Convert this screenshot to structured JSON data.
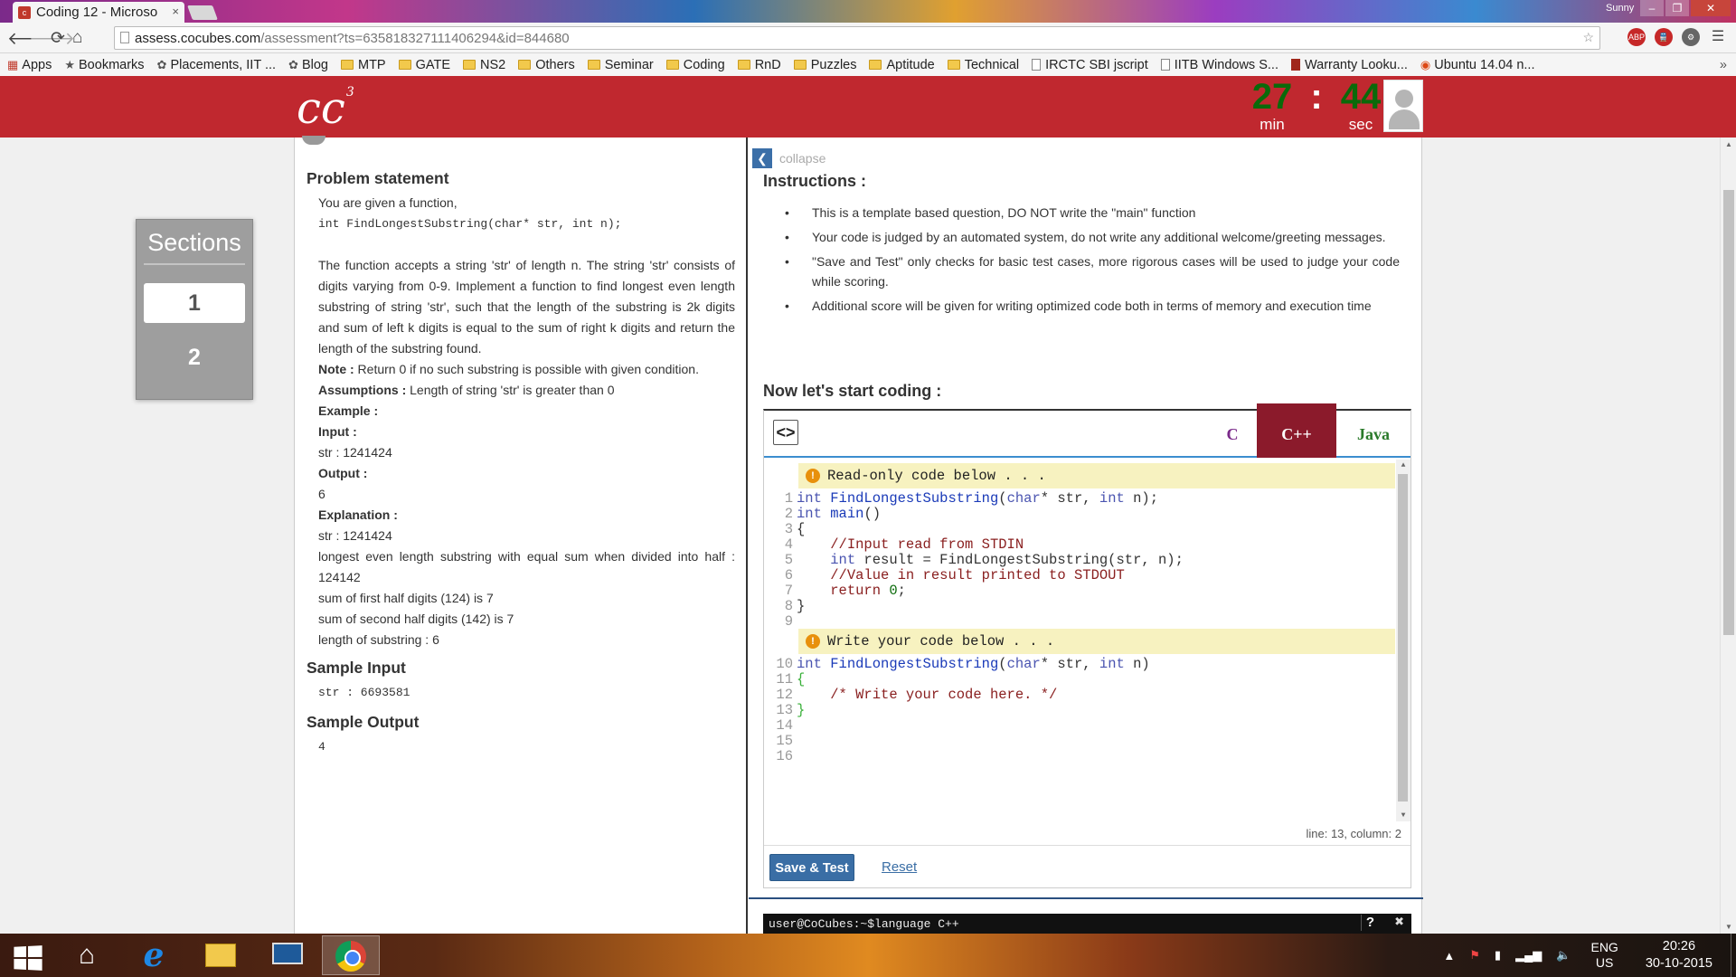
{
  "browser": {
    "tab_title": "Coding 12 - Microso",
    "tab_close": "×",
    "profile_name": "Sunny",
    "url_host": "assess.cocubes.com",
    "url_path": "/assessment?ts=635818327111406294&id=844680",
    "bookmarks": [
      {
        "label": "Apps",
        "kind": "apps"
      },
      {
        "label": "Bookmarks",
        "kind": "star"
      },
      {
        "label": "Placements, IIT ...",
        "kind": "glyph"
      },
      {
        "label": "Blog",
        "kind": "glyph"
      },
      {
        "label": "MTP",
        "kind": "folder"
      },
      {
        "label": "GATE",
        "kind": "folder"
      },
      {
        "label": "NS2",
        "kind": "folder"
      },
      {
        "label": "Others",
        "kind": "folder"
      },
      {
        "label": "Seminar",
        "kind": "folder"
      },
      {
        "label": "Coding",
        "kind": "folder"
      },
      {
        "label": "RnD",
        "kind": "folder"
      },
      {
        "label": "Puzzles",
        "kind": "folder"
      },
      {
        "label": "Aptitude",
        "kind": "folder"
      },
      {
        "label": "Technical",
        "kind": "folder"
      },
      {
        "label": "IRCTC SBI jscript",
        "kind": "page"
      },
      {
        "label": "IITB Windows S...",
        "kind": "page"
      },
      {
        "label": "Warranty Looku...",
        "kind": "page"
      },
      {
        "label": "Ubuntu 14.04 n...",
        "kind": "page"
      }
    ]
  },
  "header": {
    "logo_text": "c",
    "logo_sup": "3",
    "timer": {
      "minutes": "27",
      "seconds": "44",
      "min_label": "min",
      "sec_label": "sec",
      "separator": ":"
    }
  },
  "sections": {
    "title": "Sections",
    "items": [
      "1",
      "2"
    ]
  },
  "problem": {
    "heading": "Problem statement",
    "intro": "You are given a function,",
    "signature": "int FindLongestSubstring(char* str, int n);",
    "description": "The function accepts a string 'str' of length n. The string 'str' consists of digits varying from 0-9. Implement a function to find longest even length substring of string 'str', such that the length of the substring is 2k digits and sum of left k digits is equal to the sum of right k digits and return the length of the substring found.",
    "note_label": "Note :",
    "note_text": " Return 0 if no such substring is possible with given condition.",
    "assumptions_label": "Assumptions :",
    "assumptions_text": " Length of string 'str' is greater than 0",
    "example_label": "Example :",
    "input_label": "Input :",
    "input_value": "str : 1241424",
    "output_label": "Output :",
    "output_value": "6",
    "explanation_label": "Explanation :",
    "explanation_lines": [
      "str : 1241424",
      "longest even length substring with equal sum when divided into half : 124142",
      "sum of first half digits (124) is 7",
      "sum of second half digits (142) is 7",
      "length of substring : 6"
    ],
    "sample_input_heading": "Sample Input",
    "sample_input": "str : 6693581",
    "sample_output_heading": "Sample Output",
    "sample_output": "4"
  },
  "instructions": {
    "collapse_label": "collapse",
    "heading": "Instructions :",
    "items": [
      "This is a template based question, DO NOT write the \"main\" function",
      "Your code is judged by an automated system, do not write any additional welcome/greeting messages.",
      "\"Save and Test\" only checks for basic test cases, more rigorous cases will be used to judge your code while scoring.",
      "Additional score will be given for writing optimized code both in terms of memory and execution time"
    ],
    "coding_heading": "Now let's start coding :"
  },
  "editor": {
    "code_icon": "<>",
    "languages": [
      "C",
      "C++",
      "Java"
    ],
    "selected_language": "C++",
    "readonly_banner": "Read-only code below . . .",
    "write_banner": "Write your code below . . .",
    "status": "line: 13, column: 2",
    "save_label": "Save & Test",
    "reset_label": "Reset"
  },
  "console": {
    "text": "user@CoCubes:~$language C++",
    "help": "?"
  },
  "taskbar": {
    "lang_top": "ENG",
    "lang_bottom": "US",
    "time": "20:26",
    "date": "30-10-2015"
  }
}
